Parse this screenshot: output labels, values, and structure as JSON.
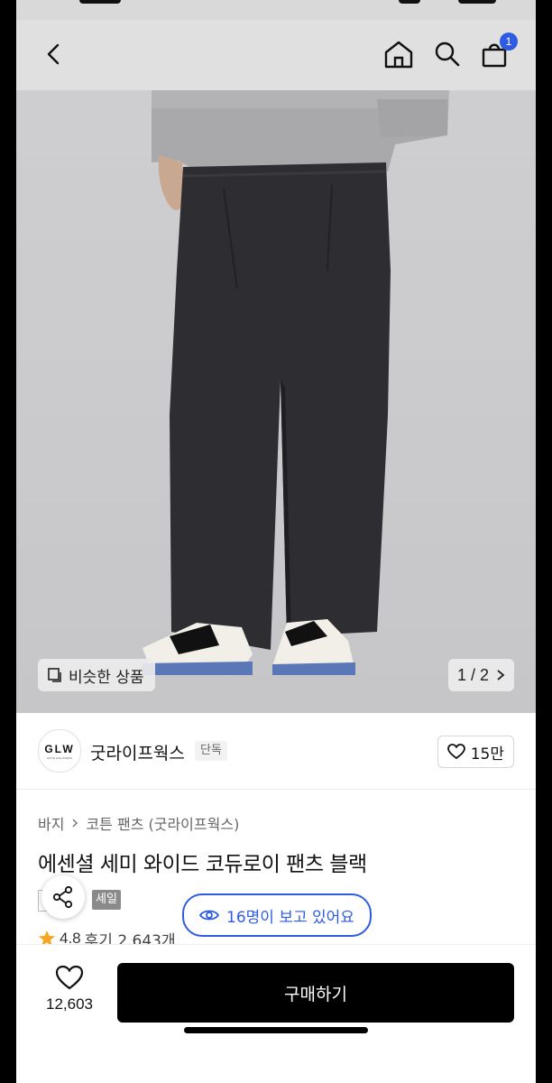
{
  "brand": {
    "logo_mark": "GLW",
    "logo_sub": "GOOD LIFE WORKS",
    "name": "굿라이프웍스",
    "exclusive_tag": "단독",
    "likes": "15만"
  },
  "gallery": {
    "similar_label": "비슷한 상품",
    "page_indicator": "1 / 2"
  },
  "header": {
    "cart_badge": "1",
    "icons": [
      "back-icon",
      "home-icon",
      "search-icon",
      "cart-icon"
    ]
  },
  "breadcrumb": {
    "category": "바지",
    "subcategory": "코튼 팬츠 (굿라이프웍스)"
  },
  "product": {
    "title": "에센셜 세미 와이드 코듀로이 팬츠 블랙",
    "sale_tag": "세일",
    "viewers": "16명이 보고 있어요",
    "rating": "4.8",
    "reviews": "후기 2,643개"
  },
  "bottom_bar": {
    "wish_count": "12,603",
    "buy_label": "구매하기"
  },
  "colors": {
    "accent_blue": "#2f5be0",
    "buy_button": "#000000",
    "star": "#f5a623"
  }
}
